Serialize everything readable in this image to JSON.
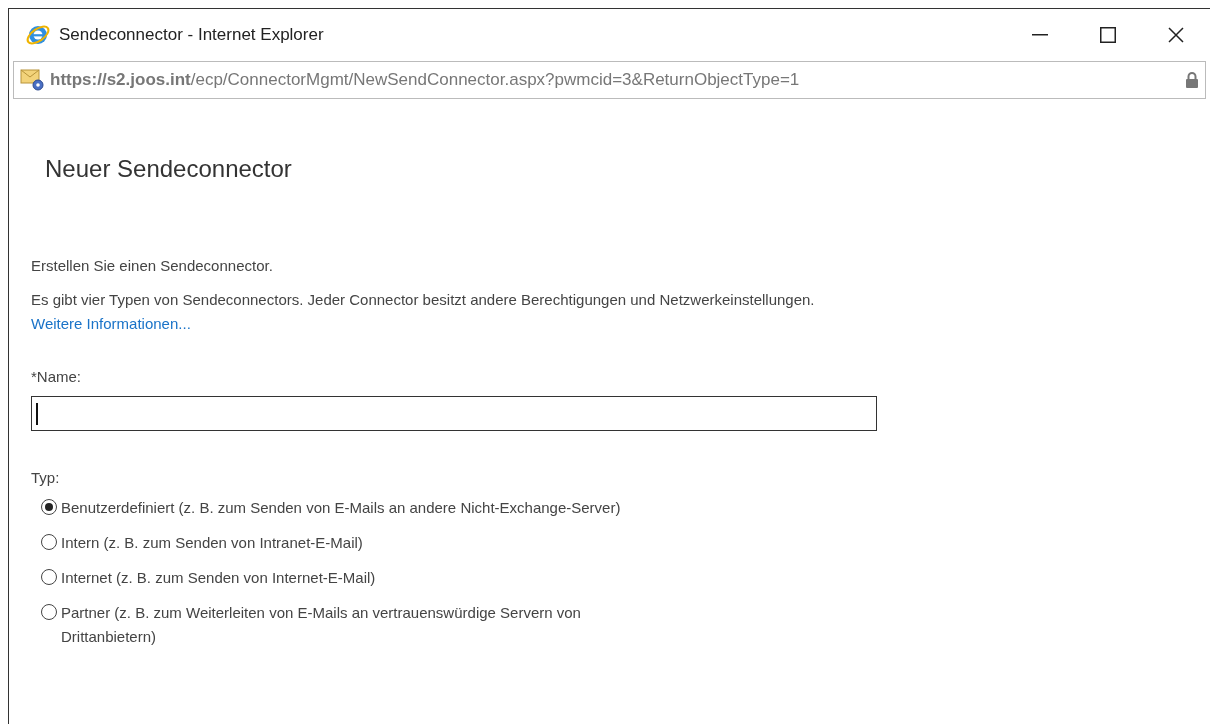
{
  "window": {
    "title": "Sendeconnector - Internet Explorer"
  },
  "address_bar": {
    "url": "**https://s2.joos.int**/ecp/ConnectorMgmt/NewSendConnector.aspx?pwmcid=3&ReturnObjectType=1"
  },
  "page": {
    "heading": "Neuer Sendeconnector",
    "intro": "Erstellen Sie einen Sendeconnector.",
    "description": "Es gibt vier Typen von Sendeconnectors. Jeder Connector besitzt andere Berechtigungen und Netzwerkeinstellungen.",
    "link": "Weitere Informationen...",
    "name_field": {
      "label": "*Name:",
      "focused": true
    },
    "type_label": "Typ:",
    "types": [
      {
        "label": "Benutzerdefiniert (z. B. zum Senden von E-Mails an andere Nicht-Exchange-Server)",
        "selected": true
      },
      {
        "label": "Intern (z. B. zum Senden von Intranet-E-Mail)",
        "selected": false
      },
      {
        "label": "Internet (z. B. zum Senden von Internet-E-Mail)",
        "selected": false
      },
      {
        "label": "Partner (z. B. zum Weiterleiten von E-Mails an vertrauenswürdige Servern von Drittanbietern)",
        "selected": false
      }
    ]
  }
}
